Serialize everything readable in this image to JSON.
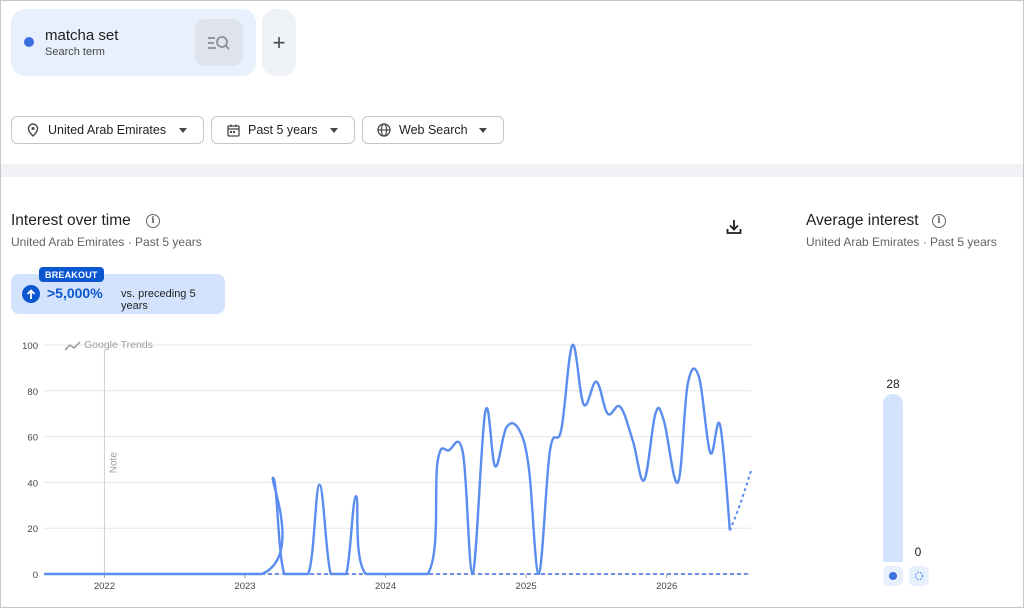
{
  "search_term": {
    "title": "matcha set",
    "subtitle": "Search term",
    "color": "#3c6fe0",
    "compare_icon": "search-list-icon",
    "add_label": "+"
  },
  "filters": [
    {
      "label": "United Arab Emirates",
      "icon": "location-pin-icon"
    },
    {
      "label": "Past 5 years",
      "icon": "calendar-icon"
    },
    {
      "label": "Web Search",
      "icon": "globe-icon"
    }
  ],
  "interest_over_time": {
    "title": "Interest over time",
    "subtitle": "United Arab Emirates · Past 5 years",
    "breakout_tag": "BREAKOUT",
    "breakout_value": ">5,000%",
    "breakout_text": "vs. preceding 5 years",
    "watermark": "Google Trends",
    "note_label": "Note"
  },
  "average_interest": {
    "title": "Average interest",
    "subtitle": "United Arab Emirates · Past 5 years",
    "values": [
      {
        "label": "28",
        "value": 28,
        "color": "#3c6fe0"
      },
      {
        "label": "0",
        "value": 0,
        "color": "#3c6fe0"
      }
    ]
  },
  "chart_data": {
    "type": "line",
    "title": "",
    "xlabel": "",
    "ylabel": "",
    "ylim": [
      0,
      100
    ],
    "yticks": [
      0,
      20,
      40,
      60,
      80,
      100
    ],
    "xticks": [
      "2022",
      "2023",
      "2024",
      "2025",
      "2026"
    ],
    "xlim": [
      2021.57,
      2026.6
    ],
    "grid": true,
    "series": [
      {
        "color": "#5b8def",
        "points": [
          [
            2021.57,
            0
          ],
          [
            2023.12,
            0
          ],
          [
            2023.2,
            42
          ],
          [
            2023.28,
            0
          ],
          [
            2023.45,
            0
          ],
          [
            2023.53,
            39
          ],
          [
            2023.61,
            0
          ],
          [
            2023.72,
            0
          ],
          [
            2023.79,
            34
          ],
          [
            2023.86,
            0
          ],
          [
            2024.3,
            0
          ],
          [
            2024.37,
            49
          ],
          [
            2024.45,
            54
          ],
          [
            2024.55,
            53
          ],
          [
            2024.62,
            0
          ],
          [
            2024.71,
            71
          ],
          [
            2024.78,
            47
          ],
          [
            2024.86,
            64
          ],
          [
            2024.95,
            63
          ],
          [
            2025.02,
            46
          ],
          [
            2025.09,
            0
          ],
          [
            2025.17,
            54
          ],
          [
            2025.25,
            63
          ],
          [
            2025.33,
            100
          ],
          [
            2025.41,
            74
          ],
          [
            2025.5,
            84
          ],
          [
            2025.58,
            70
          ],
          [
            2025.67,
            73
          ],
          [
            2025.76,
            58
          ],
          [
            2025.84,
            41
          ],
          [
            2025.92,
            70
          ],
          [
            2025.98,
            67
          ],
          [
            2026.08,
            40
          ],
          [
            2026.15,
            83
          ],
          [
            2026.23,
            86
          ],
          [
            2026.31,
            53
          ],
          [
            2026.38,
            65
          ],
          [
            2026.45,
            19
          ]
        ],
        "partial_points": [
          [
            2026.45,
            19
          ],
          [
            2026.52,
            30
          ],
          [
            2026.6,
            45
          ]
        ]
      },
      {
        "color": "#3c6fe0",
        "dashed": true,
        "points": [
          [
            2021.57,
            0
          ],
          [
            2026.6,
            0
          ]
        ]
      }
    ]
  }
}
